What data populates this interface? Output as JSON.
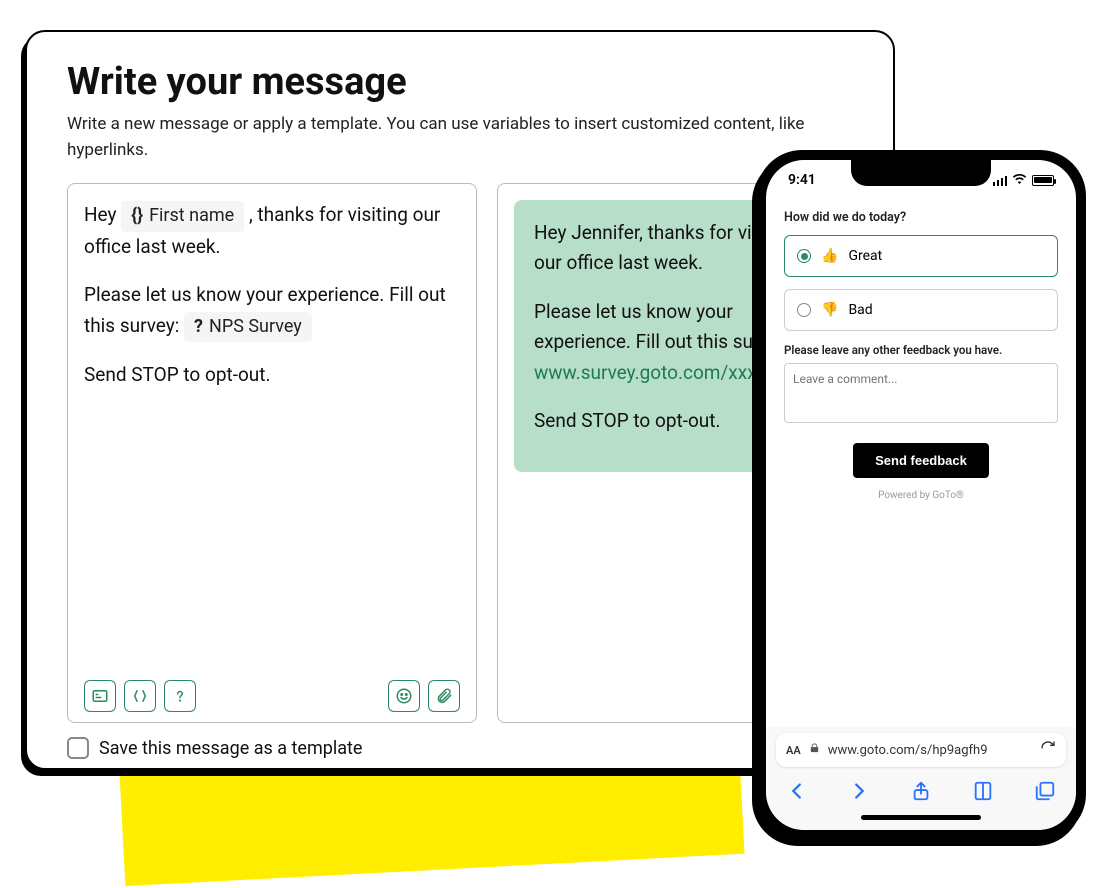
{
  "composer": {
    "title": "Write your message",
    "subtitle": "Write a new message or apply a template. You can use variables to insert customized content, like hyperlinks.",
    "editor": {
      "line1_prefix": "Hey ",
      "var_firstname": "First name",
      "line1_suffix": ", thanks for visiting our office last week.",
      "line2_prefix": "Please let us know your experience. Fill out this survey: ",
      "var_survey": "NPS Survey",
      "line3": "Send STOP to opt-out."
    },
    "save_template_label": "Save this message as a template"
  },
  "preview": {
    "p1": "Hey Jennifer, thanks for visiting our office last week.",
    "p2a": "Please let us know your experience. Fill out this survey: ",
    "link": "www.survey.goto.com/xxxxx",
    "p3": "Send STOP to opt-out."
  },
  "phone": {
    "time": "9:41",
    "question": "How did we do today?",
    "opt_great": "Great",
    "opt_bad": "Bad",
    "feedback_label": "Please leave any other feedback you have.",
    "comment_placeholder": "Leave a comment...",
    "send_btn": "Send feedback",
    "powered": "Powered by GoTo®",
    "aa": "AA",
    "url": "www.goto.com/s/hp9agfh9"
  }
}
